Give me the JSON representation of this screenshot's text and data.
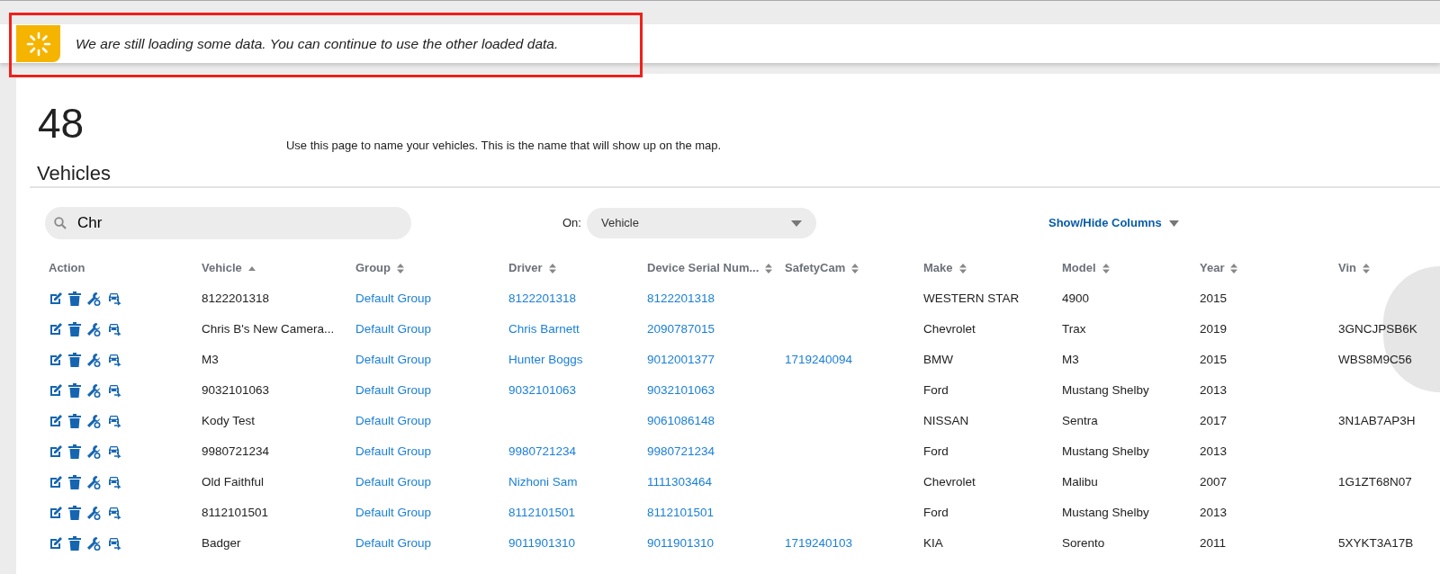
{
  "alert": {
    "message": "We are still loading some data. You can continue to use the other loaded data.",
    "highlighted": true
  },
  "header": {
    "count": "48",
    "title": "Vehicles",
    "description": "Use this page to name your vehicles. This is the name that will show up on the map."
  },
  "search": {
    "value": "Chr"
  },
  "filter": {
    "label": "On:",
    "value": "Vehicle"
  },
  "show_hide_columns": "Show/Hide Columns",
  "table": {
    "columns": [
      {
        "label": "Action"
      },
      {
        "label": "Vehicle",
        "sorted": true,
        "link": false
      },
      {
        "label": "Group",
        "sorted": false,
        "link": true
      },
      {
        "label": "Driver",
        "sorted": false,
        "link": true
      },
      {
        "label": "Device Serial Num...",
        "sorted": false,
        "link": true
      },
      {
        "label": "SafetyCam",
        "sorted": false,
        "link": true
      },
      {
        "label": "Make",
        "sorted": false,
        "link": false
      },
      {
        "label": "Model",
        "sorted": false,
        "link": false
      },
      {
        "label": "Year",
        "sorted": false,
        "link": false
      },
      {
        "label": "Vin",
        "sorted": false,
        "link": false
      }
    ],
    "rows": [
      [
        "",
        "8122201318",
        "Default Group",
        "8122201318",
        "8122201318",
        null,
        "WESTERN STAR",
        "4900",
        "2015",
        null
      ],
      [
        "",
        "Chris B's New Camera...",
        "Default Group",
        "Chris Barnett",
        "2090787015",
        null,
        "Chevrolet",
        "Trax",
        "2019",
        "3GNCJPSB6K"
      ],
      [
        "",
        "M3",
        "Default Group",
        "Hunter Boggs",
        "9012001377",
        "1719240094",
        "BMW",
        "M3",
        "2015",
        "WBS8M9C56"
      ],
      [
        "",
        "9032101063",
        "Default Group",
        "9032101063",
        "9032101063",
        null,
        "Ford",
        "Mustang Shelby",
        "2013",
        null
      ],
      [
        "",
        "Kody Test",
        "Default Group",
        null,
        "9061086148",
        null,
        "NISSAN",
        "Sentra",
        "2017",
        "3N1AB7AP3H"
      ],
      [
        "",
        "9980721234",
        "Default Group",
        "9980721234",
        "9980721234",
        null,
        "Ford",
        "Mustang Shelby",
        "2013",
        null
      ],
      [
        "",
        "Old Faithful",
        "Default Group",
        "Nizhoni Sam",
        "1111303464",
        null,
        "Chevrolet",
        "Malibu",
        "2007",
        "1G1ZT68N07"
      ],
      [
        "",
        "8112101501",
        "Default Group",
        "8112101501",
        "8112101501",
        null,
        "Ford",
        "Mustang Shelby",
        "2013",
        null
      ],
      [
        "",
        "Badger",
        "Default Group",
        "9011901310",
        "9011901310",
        "1719240103",
        "KIA",
        "Sorento",
        "2011",
        "5XYKT3A17B"
      ]
    ]
  }
}
